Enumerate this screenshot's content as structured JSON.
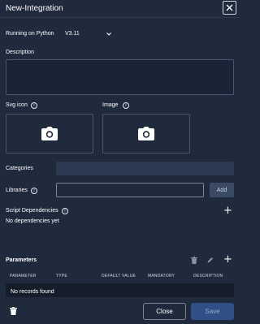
{
  "header": {
    "title": "New-Integration"
  },
  "runtime": {
    "label": "Running on Python",
    "value": "V3.11"
  },
  "description": {
    "label": "Description",
    "value": ""
  },
  "svg_icon": {
    "label": "Svg icon"
  },
  "image": {
    "label": "Image"
  },
  "categories": {
    "label": "Categories"
  },
  "libraries": {
    "label": "Libraries",
    "value": "",
    "add_label": "Add"
  },
  "dependencies": {
    "label": "Script Dependencies",
    "empty_text": "No dependencies yet"
  },
  "parameters": {
    "title": "Parameters",
    "columns": [
      "PARAMETER",
      "TYPE",
      "DEFAULT VALUE",
      "MANDATORY",
      "DESCRIPTION"
    ],
    "empty_text": "No records found"
  },
  "footer": {
    "close_label": "Close",
    "save_label": "Save"
  },
  "colors": {
    "background": "#1f2a3c",
    "primary_button": "#2f4f86",
    "border": "#4a5670"
  },
  "icons": [
    "close-icon",
    "chevron-down-icon",
    "info-icon",
    "camera-icon",
    "plus-icon",
    "trash-icon",
    "pencil-icon"
  ]
}
